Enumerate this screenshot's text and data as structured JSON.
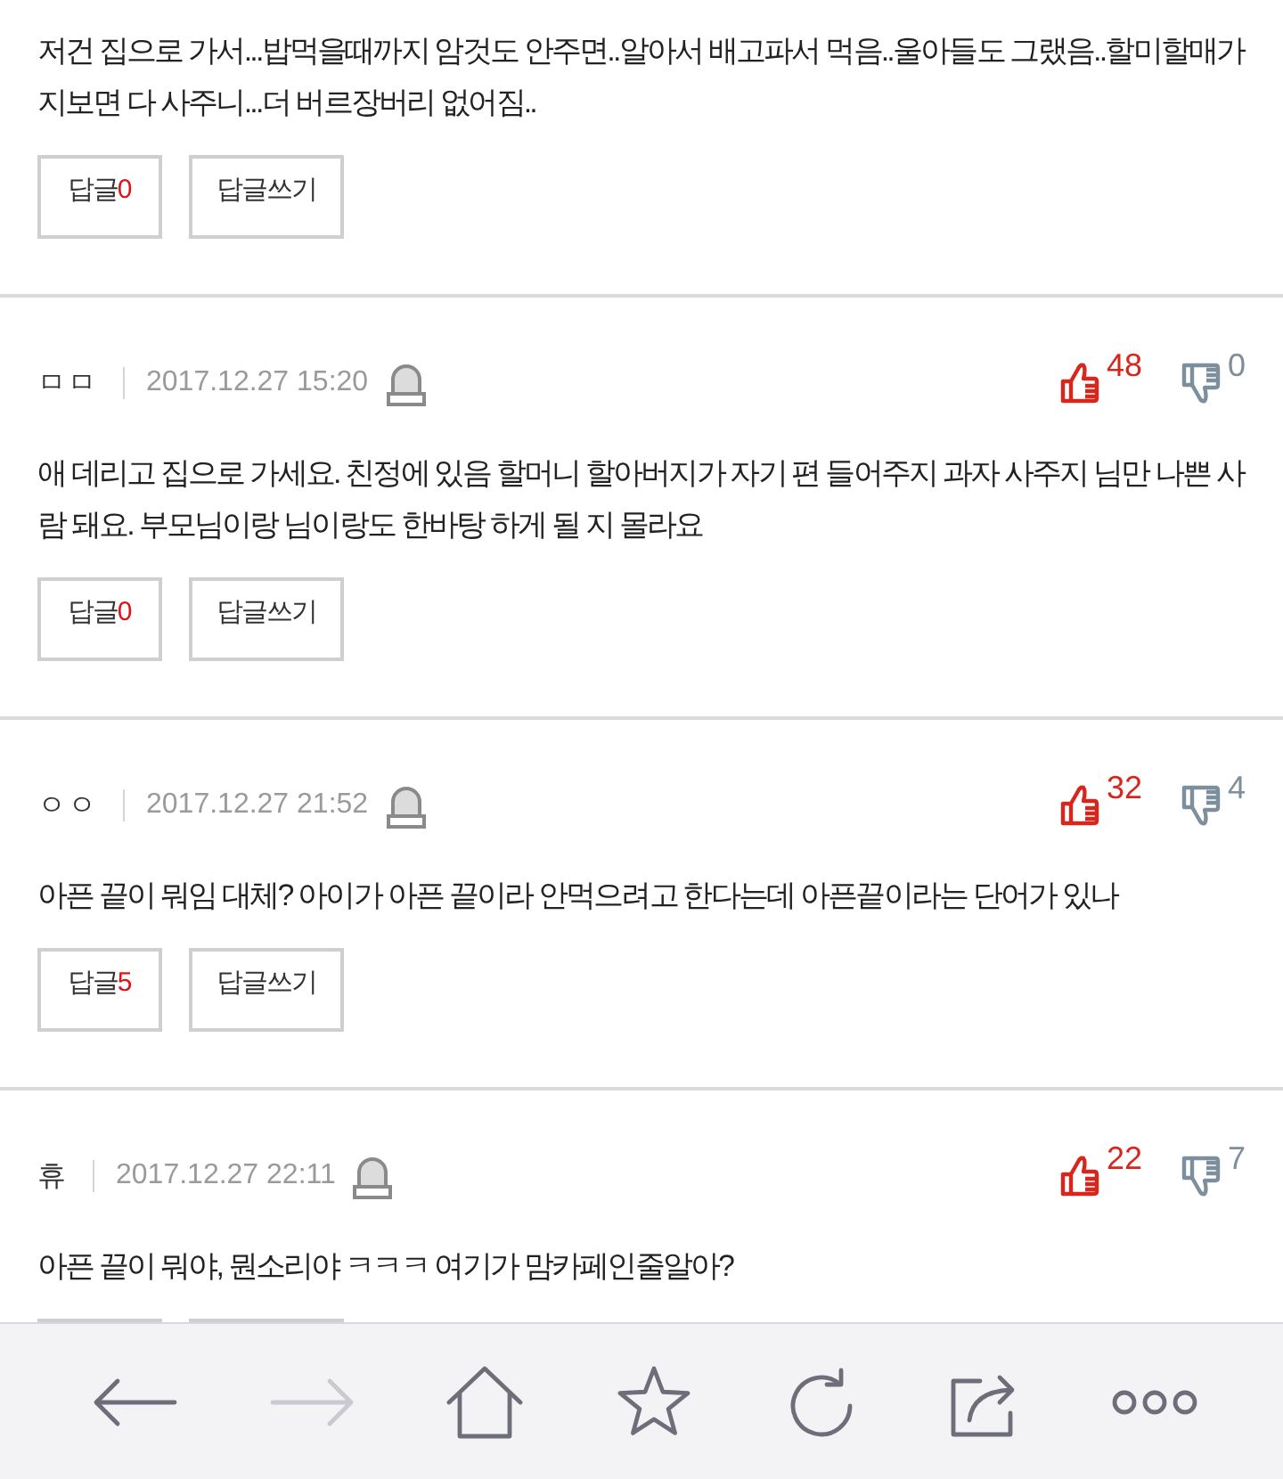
{
  "comments": [
    {
      "kind": "full",
      "body": "저건 집으로 가서...밥먹을때까지 암것도 안주면..알아서 배고파서 먹음..울아들도 그랬음..할미할매가 지보면 다 사주니...더 버르장버리 없어짐..",
      "reply_label": "답글",
      "reply_count": "0",
      "write_label": "답글쓰기"
    },
    {
      "kind": "full",
      "author": "ㅁㅁ",
      "date": "2017.12.27 15:20",
      "likes": "48",
      "dislikes": "0",
      "body": "애 데리고 집으로 가세요. 친정에 있음 할머니 할아버지가 자기 편 들어주지 과자 사주지 님만 나쁜 사람 돼요. 부모님이랑 님이랑도 한바탕 하게 될 지 몰라요",
      "reply_label": "답글",
      "reply_count": "0",
      "write_label": "답글쓰기"
    },
    {
      "kind": "full",
      "author": "ㅇㅇ",
      "date": "2017.12.27 21:52",
      "likes": "32",
      "dislikes": "4",
      "body": "아픈 끝이 뭐임 대체? 아이가 아픈 끝이라 안먹으려고 한다는데 아픈끝이라는 단어가 있나",
      "reply_label": "답글",
      "reply_count": "5",
      "write_label": "답글쓰기"
    },
    {
      "kind": "cut",
      "author": "휴",
      "date": "2017.12.27 22:11",
      "likes": "22",
      "dislikes": "7",
      "body": "아픈 끝이 뭐야, 뭔소리야 ㅋㅋㅋ 여기가 맘카페인줄알아?"
    }
  ],
  "toolbar": [
    {
      "kind": "back",
      "disabled": false
    },
    {
      "kind": "forward",
      "disabled": true
    },
    {
      "kind": "home",
      "disabled": false
    },
    {
      "kind": "star",
      "disabled": false
    },
    {
      "kind": "refresh",
      "disabled": false
    },
    {
      "kind": "share",
      "disabled": false
    },
    {
      "kind": "more",
      "disabled": false
    }
  ]
}
